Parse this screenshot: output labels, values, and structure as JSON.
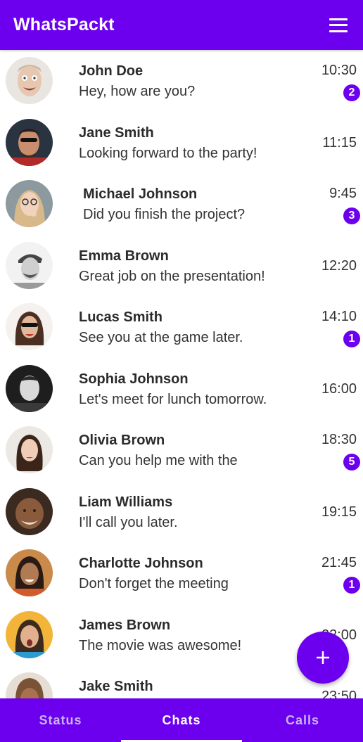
{
  "app_bar": {
    "title": "WhatsPackt",
    "menu_icon": "hamburger-menu-icon"
  },
  "chats": [
    {
      "name": "John Doe",
      "message": "Hey, how are you?",
      "time": "10:30",
      "unread": "2"
    },
    {
      "name": "Jane Smith",
      "message": "Looking forward to the party!",
      "time": "11:15",
      "unread": ""
    },
    {
      "name": "Michael Johnson",
      "message": "Did you finish the project?",
      "time": "9:45",
      "unread": "3"
    },
    {
      "name": "Emma Brown",
      "message": "Great job on the presentation!",
      "time": "12:20",
      "unread": ""
    },
    {
      "name": "Lucas Smith",
      "message": "See you at the game later.",
      "time": "14:10",
      "unread": "1"
    },
    {
      "name": "Sophia Johnson",
      "message": "Let's meet for lunch tomorrow.",
      "time": "16:00",
      "unread": ""
    },
    {
      "name": "Olivia Brown",
      "message": "Can you help me with the",
      "time": "18:30",
      "unread": "5"
    },
    {
      "name": "Liam Williams",
      "message": "I'll call you later.",
      "time": "19:15",
      "unread": ""
    },
    {
      "name": "Charlotte Johnson",
      "message": "Don't forget the meeting",
      "time": "21:45",
      "unread": "1"
    },
    {
      "name": "James Brown",
      "message": "The movie was awesome!",
      "time": "22:00",
      "unread": ""
    },
    {
      "name": "Jake Smith",
      "message": "",
      "time": "23:50",
      "unread": ""
    }
  ],
  "fab": {
    "icon": "plus-icon"
  },
  "tabs": [
    {
      "label": "Status",
      "active": false
    },
    {
      "label": "Chats",
      "active": true
    },
    {
      "label": "Calls",
      "active": false
    }
  ],
  "colors": {
    "primary": "#6c00ee",
    "inactive_tab": "#c9b3f2"
  }
}
